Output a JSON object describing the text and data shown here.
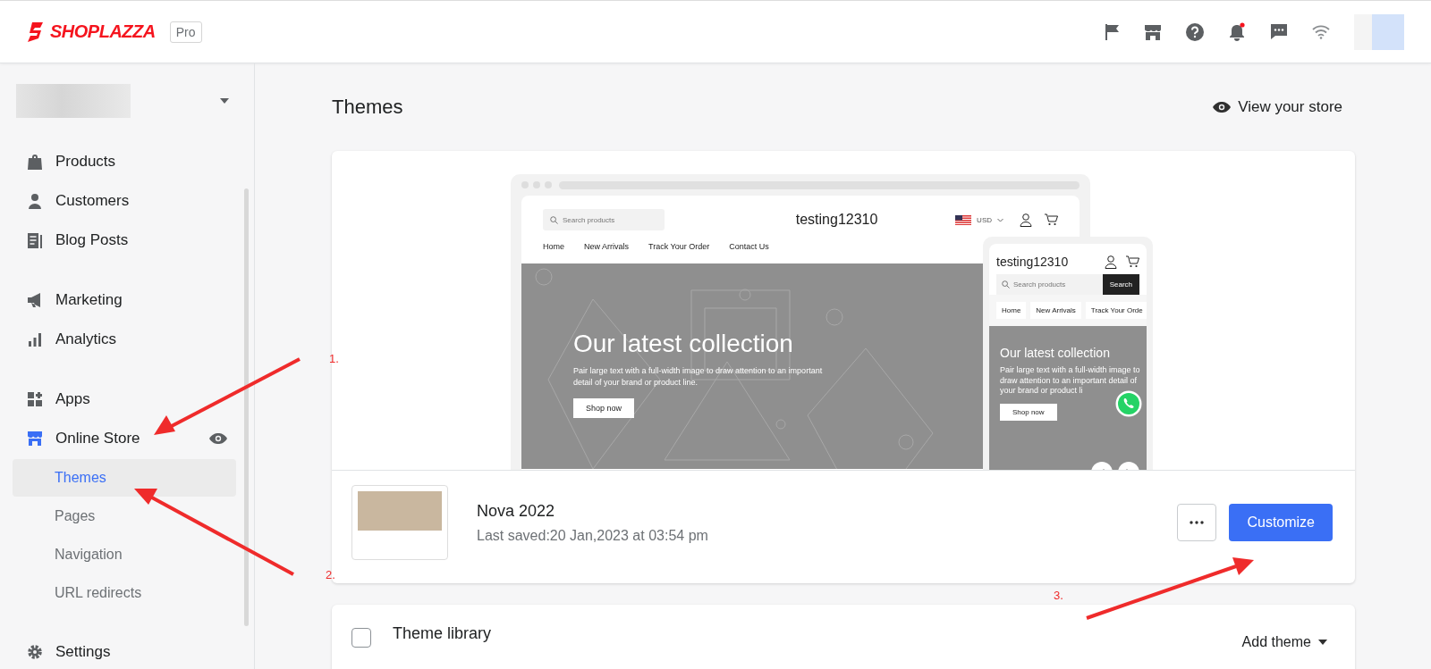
{
  "header": {
    "logo": "SHOPLAZZA",
    "plan_badge": "Pro",
    "has_unread_notifications": true
  },
  "sidebar": {
    "sections": [
      {
        "items": [
          {
            "label": "Products",
            "selected": false
          },
          {
            "label": "Customers",
            "selected": false
          },
          {
            "label": "Blog Posts",
            "selected": false
          }
        ]
      },
      {
        "items": [
          {
            "label": "Marketing",
            "selected": false
          },
          {
            "label": "Analytics",
            "selected": false
          }
        ]
      },
      {
        "items": [
          {
            "label": "Apps",
            "selected": false
          },
          {
            "label": "Online Store",
            "selected": false,
            "expanded": true,
            "children": [
              {
                "label": "Themes",
                "selected": true
              },
              {
                "label": "Pages",
                "selected": false
              },
              {
                "label": "Navigation",
                "selected": false
              },
              {
                "label": "URL redirects",
                "selected": false
              }
            ]
          }
        ]
      },
      {
        "items": [
          {
            "label": "Settings",
            "selected": false
          }
        ]
      }
    ]
  },
  "page": {
    "title": "Themes",
    "view_store_link": "View your store"
  },
  "preview": {
    "desktop": {
      "search_placeholder": "Search products",
      "store_name": "testing12310",
      "currency": "USD",
      "nav": [
        "Home",
        "New Arrivals",
        "Track Your Order",
        "Contact Us"
      ],
      "hero_title": "Our latest collection",
      "hero_text": "Pair large text with a full-width image to draw attention to an important detail of your brand or product line.",
      "hero_button": "Shop now"
    },
    "mobile": {
      "store_name": "testing12310",
      "search_placeholder": "Search products",
      "search_button": "Search",
      "nav": [
        "Home",
        "New Arrivals",
        "Track Your Orde"
      ],
      "hero_title": "Our latest collection",
      "hero_text": "Pair large text with a full-width image to draw attention to an important detail of your brand or product li",
      "hero_button": "Shop now"
    }
  },
  "current_theme": {
    "name": "Nova 2022",
    "last_saved": "Last saved:20 Jan,2023 at 03:54 pm",
    "customize_button": "Customize"
  },
  "theme_library": {
    "title": "Theme library",
    "checked": false,
    "add_button": "Add theme"
  },
  "annotations": [
    {
      "label": "1."
    },
    {
      "label": "2."
    },
    {
      "label": "3."
    }
  ]
}
